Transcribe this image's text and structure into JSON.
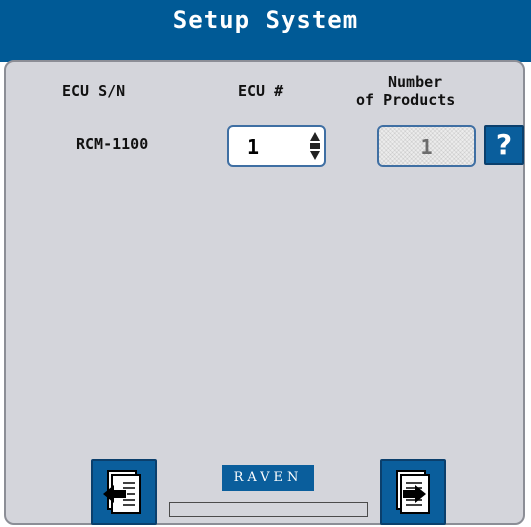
{
  "window": {
    "title": "Setup System"
  },
  "table": {
    "headers": {
      "ecu_sn": "ECU S/N",
      "ecu_number": "ECU #",
      "products_line1": "Number",
      "products_line2": "of Products"
    },
    "row": {
      "ecu_sn": "RCM-1100",
      "ecu_number": "1",
      "products": "1"
    }
  },
  "help": {
    "label": "?"
  },
  "footer": {
    "logo_text": "RAVEN",
    "back_icon": "back-arrow-page-icon",
    "next_icon": "next-arrow-page-icon",
    "progress": 0
  },
  "colors": {
    "title_bar": "#005a96",
    "panel": "#d4d5db",
    "button": "#0a5e9c"
  }
}
